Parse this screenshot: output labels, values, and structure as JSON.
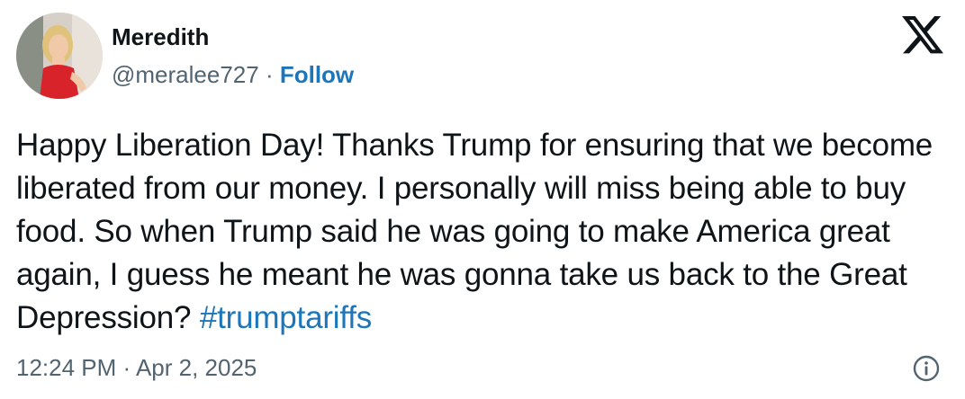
{
  "author": {
    "display_name": "Meredith",
    "handle": "@meralee727",
    "separator": " · ",
    "follow_label": "Follow"
  },
  "tweet": {
    "text": "Happy Liberation Day! Thanks Trump for ensuring that we become liberated from our money. I personally will miss being able to buy food. So when Trump said he was going to make America great again, I guess he meant he was gonna take us back to the Great Depression? ",
    "hashtag": "#trumptariffs",
    "timestamp": "12:24 PM · Apr 2, 2025"
  },
  "icons": {
    "brand": "x-logo-icon",
    "info": "info-icon"
  },
  "colors": {
    "text": "#0f1419",
    "secondary": "#536471",
    "link": "#1d76ba",
    "background": "#ffffff"
  }
}
